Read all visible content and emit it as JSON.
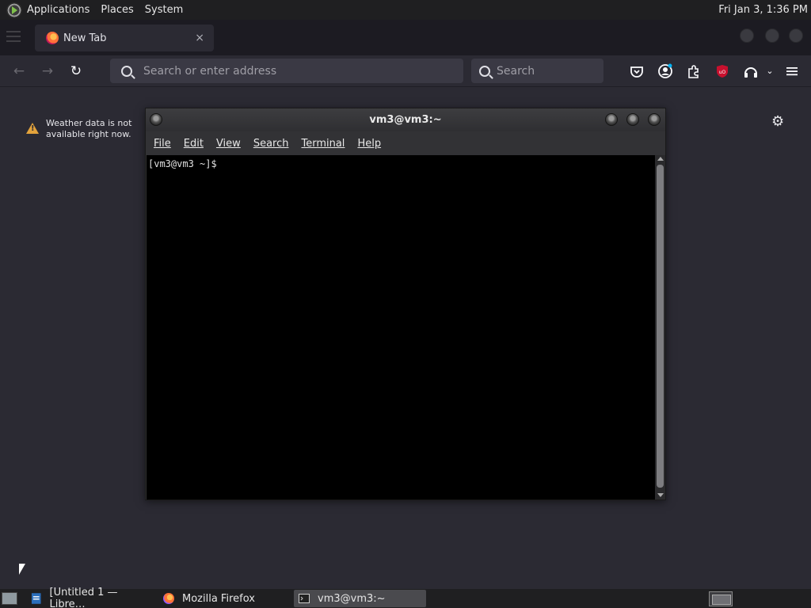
{
  "top_panel": {
    "menus": [
      "Applications",
      "Places",
      "System"
    ],
    "clock": "Fri Jan  3,  1:36 PM"
  },
  "firefox": {
    "tab": {
      "title": "New Tab",
      "close": "×"
    },
    "urlbar": {
      "placeholder": "Search or enter address"
    },
    "searchbar": {
      "placeholder": "Search"
    },
    "weather": {
      "message": "Weather data is not available right now."
    },
    "toolbar_icons": [
      "pocket-icon",
      "account-icon",
      "extensions-icon",
      "ublock-icon",
      "headphones-icon",
      "chevron-down-icon",
      "menu-icon"
    ]
  },
  "terminal": {
    "title": "vm3@vm3:~",
    "menus": [
      "File",
      "Edit",
      "View",
      "Search",
      "Terminal",
      "Help"
    ],
    "prompt": "[vm3@vm3 ~]$"
  },
  "taskbar": {
    "items": [
      {
        "label": "[Untitled 1 — Libre…",
        "icon": "libreoffice-writer-icon"
      },
      {
        "label": "Mozilla Firefox",
        "icon": "firefox-icon"
      },
      {
        "label": "vm3@vm3:~",
        "icon": "terminal-icon"
      }
    ]
  },
  "colors": {
    "firefox_dark": "#2b2a33",
    "urlbar_bg": "#3a3944",
    "panel_bg": "#1f1f21",
    "warning": "#e3a33c"
  }
}
